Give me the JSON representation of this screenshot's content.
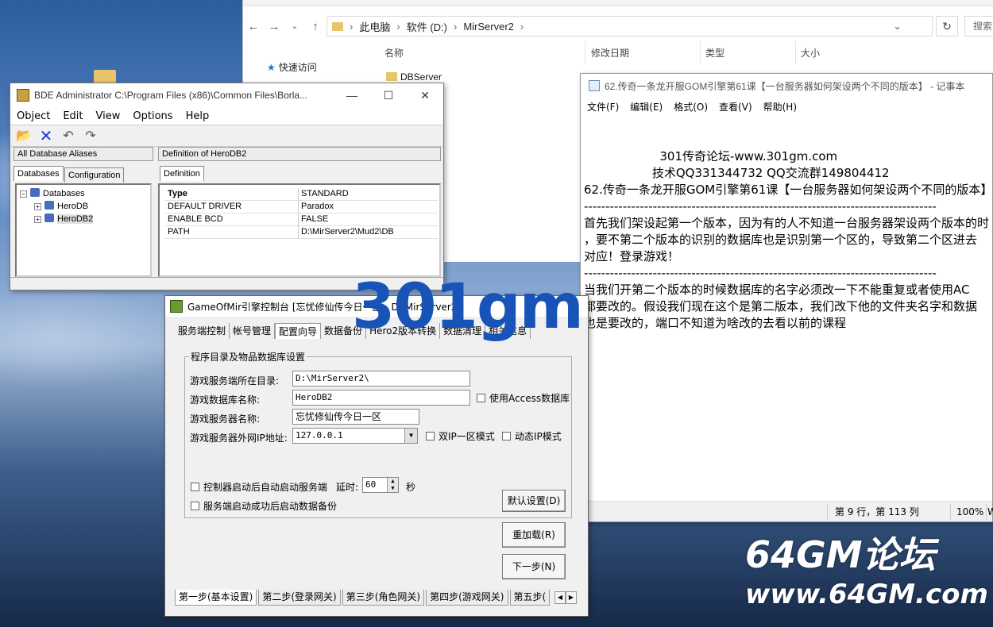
{
  "explorer": {
    "address": [
      "此电脑",
      "软件 (D:)",
      "MirServer2"
    ],
    "search_placeholder": "搜索",
    "quick_access": "快速访问",
    "columns": [
      "名称",
      "修改日期",
      "类型",
      "大小"
    ],
    "files": [
      "DBServer"
    ]
  },
  "bde": {
    "title": "BDE Administrator  C:\\Program Files (x86)\\Common Files\\Borla...",
    "menu": [
      "Object",
      "Edit",
      "View",
      "Options",
      "Help"
    ],
    "left_header": "All Database Aliases",
    "right_header": "Definition of HeroDB2",
    "tabs_left": [
      "Databases",
      "Configuration"
    ],
    "tab_right": "Definition",
    "tree": {
      "root": "Databases",
      "children": [
        "HeroDB",
        "HeroDB2"
      ]
    },
    "definition": [
      {
        "key": "Type",
        "value": "STANDARD"
      },
      {
        "key": "DEFAULT DRIVER",
        "value": "Paradox"
      },
      {
        "key": "ENABLE BCD",
        "value": "FALSE"
      },
      {
        "key": "PATH",
        "value": "D:\\MirServer2\\Mud2\\DB"
      }
    ]
  },
  "notepad": {
    "title": "62.传奇一条龙开服GOM引擎第61课【一台服务器如何架设两个不同的版本】 - 记事本",
    "menu": [
      "文件(F)",
      "编辑(E)",
      "格式(O)",
      "查看(V)",
      "帮助(H)"
    ],
    "content": "\n\n                    301传奇论坛-www.301gm.com\n                  技术QQ331344732 QQ交流群149804412\n62.传奇一条龙开服GOM引擎第61课【一台服务器如何架设两个不同的版本】\n----------------------------------------------------------------------------------\n首先我们架设起第一个版本，因为有的人不知道一台服务器架设两个版本的时候\n，要不第二个版本的识别的数据库也是识别第一个区的，导致第二个区进去\n对应！登录游戏！\n----------------------------------------------------------------------------------\n当我们开第二个版本的时候数据库的名字必须改一下不能重复或者使用AC\n都要改的。假设我们现在这个是第二版本，我们改下他的文件夹名字和数据\n也是要改的，端口不知道为啥改的去看以前的课程",
    "status_pos": "第 9 行，第 113 列",
    "status_zoom": "100%",
    "status_enc": "W"
  },
  "gom": {
    "title": "GameOfMir引擎控制台 [忘忧修仙传今日一区 - D:\\MirServer2\\]",
    "tabs": [
      "服务端控制",
      "帐号管理",
      "配置向导",
      "数据备份",
      "Hero2版本转换",
      "数据清理",
      "相关信息"
    ],
    "group_label": "程序目录及物品数据库设置",
    "labels": {
      "server_dir": "游戏服务端所在目录:",
      "db_name": "游戏数据库名称:",
      "server_name": "游戏服务器名称:",
      "ip": "游戏服务器外网IP地址:",
      "delay": "延时:",
      "seconds": "秒"
    },
    "values": {
      "server_dir": "D:\\MirServer2\\",
      "db_name": "HeroDB2",
      "server_name": "忘忧修仙传今日一区",
      "ip": "127.0.0.1",
      "delay": "60"
    },
    "checks": {
      "access": "使用Access数据库",
      "dual_ip": "双IP一区模式",
      "dynamic_ip": "动态IP模式",
      "auto_start": "控制器启动后自动启动服务端",
      "auto_backup": "服务端启动成功后启动数据备份"
    },
    "buttons": {
      "default": "默认设置(D)",
      "reload": "重加载(R)",
      "next": "下一步(N)"
    },
    "steps": [
      "第一步(基本设置)",
      "第二步(登录网关)",
      "第三步(角色网关)",
      "第四步(游戏网关)",
      "第五步("
    ]
  },
  "watermarks": {
    "brand1": "301gm",
    "brand2_line1": "64GM论坛",
    "brand2_line2": "www.64GM.com"
  }
}
